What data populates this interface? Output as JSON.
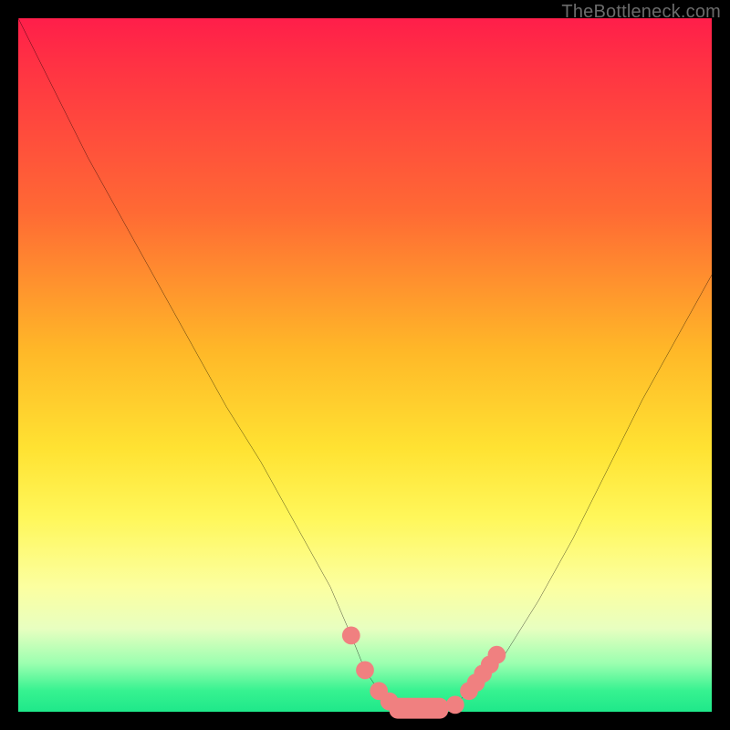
{
  "attribution": "TheBottleneck.com",
  "chart_data": {
    "type": "line",
    "title": "",
    "xlabel": "",
    "ylabel": "",
    "xlim": [
      0,
      100
    ],
    "ylim": [
      0,
      100
    ],
    "series": [
      {
        "name": "bottleneck-curve",
        "x": [
          0,
          5,
          10,
          15,
          20,
          25,
          30,
          35,
          40,
          45,
          48,
          50,
          52,
          55,
          58,
          60,
          63,
          65,
          70,
          75,
          80,
          85,
          90,
          95,
          100
        ],
        "values": [
          100,
          90,
          80,
          71,
          62,
          53,
          44,
          36,
          27,
          18,
          11,
          6,
          3,
          1,
          0,
          0,
          1,
          3,
          8,
          16,
          25,
          35,
          45,
          54,
          63
        ]
      }
    ],
    "markers": [
      {
        "name": "left-dot-1",
        "x": 48,
        "y": 11
      },
      {
        "name": "left-dot-2",
        "x": 50,
        "y": 6
      },
      {
        "name": "left-dot-3",
        "x": 52,
        "y": 3
      },
      {
        "name": "left-dot-4",
        "x": 53.5,
        "y": 1.5
      },
      {
        "name": "mid-dot-1",
        "x": 63,
        "y": 1
      },
      {
        "name": "right-dot-1",
        "x": 65,
        "y": 3
      },
      {
        "name": "right-dot-2",
        "x": 66,
        "y": 4.2
      },
      {
        "name": "right-dot-3",
        "x": 67,
        "y": 5.5
      },
      {
        "name": "right-dot-4",
        "x": 68,
        "y": 6.8
      },
      {
        "name": "right-dot-5",
        "x": 69,
        "y": 8.2
      }
    ],
    "floor_band": {
      "x0": 53.5,
      "x1": 62,
      "y": 0.5,
      "thickness": 3
    },
    "marker_color": "#f08080",
    "marker_radius": 1.3,
    "line_color": "#000000",
    "line_width": 0.35
  }
}
